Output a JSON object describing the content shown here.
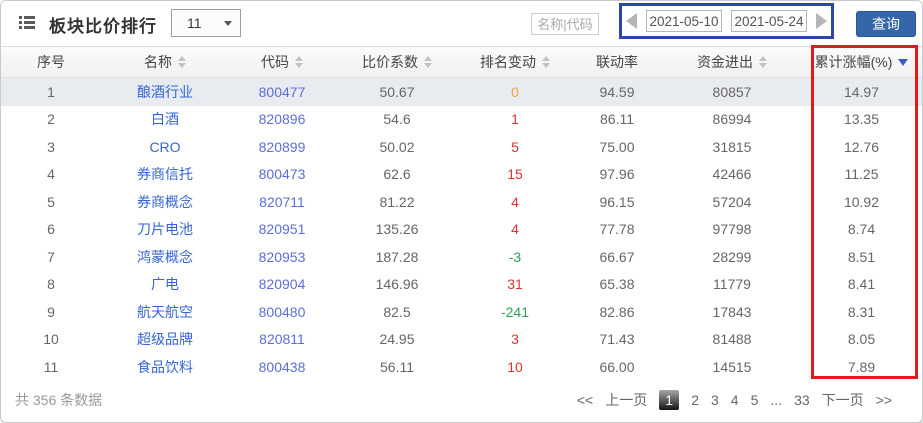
{
  "toolbar": {
    "title": "板块比价排行",
    "dropdown_value": "11",
    "search_placeholder": "名称|代码",
    "date_from": "2021-05-10",
    "date_to": "2021-05-24",
    "query_label": "查询"
  },
  "table": {
    "columns": [
      {
        "label": "序号",
        "key": "index",
        "sort": "none"
      },
      {
        "label": "名称",
        "key": "name",
        "sort": "both"
      },
      {
        "label": "代码",
        "key": "code",
        "sort": "both"
      },
      {
        "label": "比价系数",
        "key": "ratio",
        "sort": "both"
      },
      {
        "label": "排名变动",
        "key": "rank-change",
        "sort": "both"
      },
      {
        "label": "联动率",
        "key": "linkage",
        "sort": "none"
      },
      {
        "label": "资金进出",
        "key": "funds",
        "sort": "both"
      },
      {
        "label": "累计涨幅(%)",
        "key": "gain",
        "sort": "desc"
      }
    ],
    "rows": [
      {
        "index": "1",
        "name": "酿酒行业",
        "code": "800477",
        "ratio": "50.67",
        "rank_change": "0",
        "linkage": "94.59",
        "funds": "80857",
        "gain": "14.97",
        "highlight": true
      },
      {
        "index": "2",
        "name": "白酒",
        "code": "820896",
        "ratio": "54.6",
        "rank_change": "1",
        "linkage": "86.11",
        "funds": "86994",
        "gain": "13.35",
        "highlight": false
      },
      {
        "index": "3",
        "name": "CRO",
        "code": "820899",
        "ratio": "50.02",
        "rank_change": "5",
        "linkage": "75.00",
        "funds": "31815",
        "gain": "12.76",
        "highlight": false
      },
      {
        "index": "4",
        "name": "券商信托",
        "code": "800473",
        "ratio": "62.6",
        "rank_change": "15",
        "linkage": "97.96",
        "funds": "42466",
        "gain": "11.25",
        "highlight": false
      },
      {
        "index": "5",
        "name": "券商概念",
        "code": "820711",
        "ratio": "81.22",
        "rank_change": "4",
        "linkage": "96.15",
        "funds": "57204",
        "gain": "10.92",
        "highlight": false
      },
      {
        "index": "6",
        "name": "刀片电池",
        "code": "820951",
        "ratio": "135.26",
        "rank_change": "4",
        "linkage": "77.78",
        "funds": "97798",
        "gain": "8.74",
        "highlight": false
      },
      {
        "index": "7",
        "name": "鸿蒙概念",
        "code": "820953",
        "ratio": "187.28",
        "rank_change": "-3",
        "linkage": "66.67",
        "funds": "28299",
        "gain": "8.51",
        "highlight": false
      },
      {
        "index": "8",
        "name": "广电",
        "code": "820904",
        "ratio": "146.96",
        "rank_change": "31",
        "linkage": "65.38",
        "funds": "11779",
        "gain": "8.41",
        "highlight": false
      },
      {
        "index": "9",
        "name": "航天航空",
        "code": "800480",
        "ratio": "82.5",
        "rank_change": "-241",
        "linkage": "82.86",
        "funds": "17843",
        "gain": "8.31",
        "highlight": false
      },
      {
        "index": "10",
        "name": "超级品牌",
        "code": "820811",
        "ratio": "24.95",
        "rank_change": "3",
        "linkage": "71.43",
        "funds": "81488",
        "gain": "8.05",
        "highlight": false
      },
      {
        "index": "11",
        "name": "食品饮料",
        "code": "800438",
        "ratio": "56.11",
        "rank_change": "10",
        "linkage": "66.00",
        "funds": "14515",
        "gain": "7.89",
        "highlight": false
      }
    ]
  },
  "footer": {
    "total_text": "共 356 条数据",
    "pagination": [
      "<<",
      "上一页",
      "1",
      "2",
      "3",
      "4",
      "5",
      "...",
      "33",
      "下一页",
      ">>"
    ],
    "active_page": "1"
  },
  "colors": {
    "query_button_blue": "#3566a7",
    "name_link_blue": "#3565d4",
    "code_link_blue": "#5b6ed6",
    "rank_up_red": "#e23030",
    "rank_down_green": "#2f9e5a",
    "rank_zero_orange": "#f0a645",
    "active_sort_blue": "#3a5bc7",
    "highlight_row_bg": "#e8ecf1",
    "annotation_red": "#e11b1b",
    "annotation_blue": "#2b46ad"
  }
}
